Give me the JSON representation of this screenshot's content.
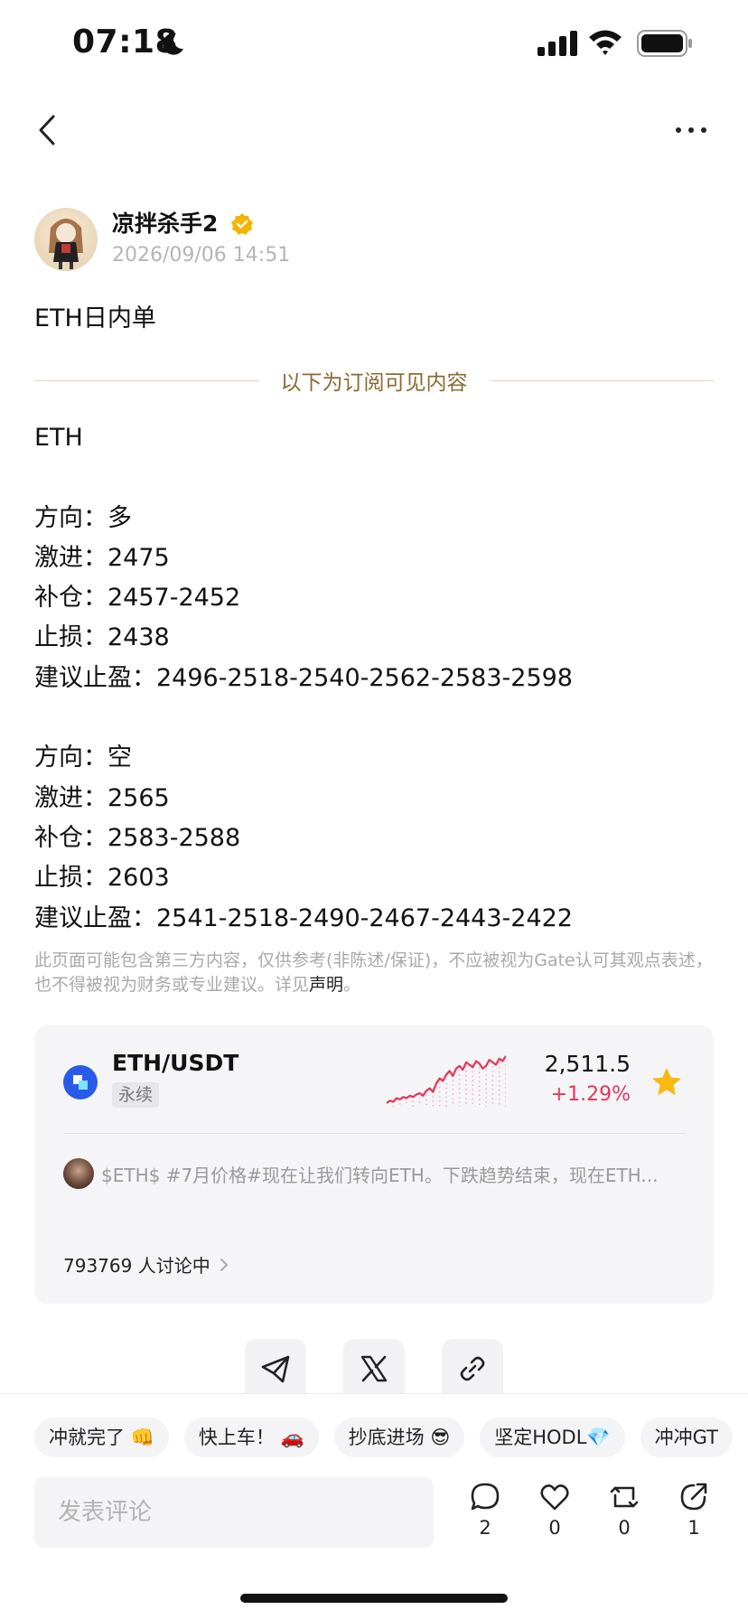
{
  "status_bar": {
    "time": "07:18"
  },
  "author": {
    "name": "凉拌杀手2",
    "post_time": "2026/09/06 14:51"
  },
  "post": {
    "title": "ETH日内单",
    "divider": "以下为订阅可见内容",
    "lines": [
      "ETH",
      "",
      "方向：多",
      "激进：2475",
      "补仓：2457-2452",
      "止损：2438",
      "建议止盈：2496-2518-2540-2562-2583-2598",
      "",
      "方向：空",
      "激进：2565",
      "补仓：2583-2588",
      "止损：2603",
      "建议止盈：2541-2518-2490-2467-2443-2422"
    ],
    "disclaimer": "此页面可能包含第三方内容，仅供参考(非陈述/保证)，不应被视为Gate认可其观点表述，也不得被视为财务或专业建议。详见",
    "disclaimer_link": "声明",
    "disclaimer_end": "。"
  },
  "market": {
    "pair": "ETH/USDT",
    "badge": "永续",
    "price": "2,511.5",
    "change": "+1.29%",
    "up_color": "#e8335a",
    "sparkline": [
      22,
      24,
      23,
      26,
      25,
      27,
      26,
      28,
      27,
      29,
      30,
      28,
      32,
      34,
      31,
      38,
      42,
      40,
      45,
      48,
      44,
      50,
      52,
      49,
      55,
      53,
      51,
      56,
      54,
      50,
      52,
      57,
      55,
      53,
      58,
      56,
      60
    ],
    "feed_text": "$ETH$ #7月价格#现在让我们转向ETH。下跌趋势结束，现在ETH...",
    "discuss": "793769 人讨论中"
  },
  "share": {
    "icons": [
      "telegram-icon",
      "x-icon",
      "link-icon"
    ]
  },
  "bottom": {
    "tags": [
      "冲就完了 👊",
      "快上车！ 🚗",
      "抄底进场 😎",
      "坚定HODL💎",
      "冲冲GT"
    ],
    "comment_placeholder": "发表评论",
    "comments": "2",
    "likes": "0",
    "reposts": "0",
    "shares": "1"
  }
}
